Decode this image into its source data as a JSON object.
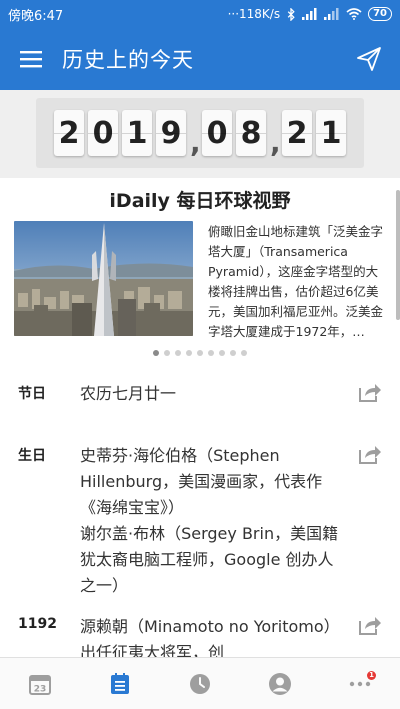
{
  "status_bar": {
    "time": "傍晚6:47",
    "network_speed": "···118K/s",
    "battery": "70"
  },
  "app_bar": {
    "title": "历史上的今天",
    "menu_icon": "hamburger-menu-icon",
    "send_icon": "paper-plane-icon"
  },
  "date": {
    "year": [
      "2",
      "0",
      "1",
      "9"
    ],
    "month": [
      "0",
      "8"
    ],
    "day": [
      "2",
      "1"
    ],
    "separator": ","
  },
  "idaily": {
    "title": "iDaily 每日环球视野",
    "summary": "俯瞰旧金山地标建筑「泛美金字塔大厦」（Transamerica Pyramid），这座金字塔型的大楼将挂牌出售，估价超过6亿美元，美国加利福尼亚州。泛美金字塔大厦建成于1972年，…",
    "dots_total": 9,
    "dots_active_index": 0
  },
  "events": [
    {
      "label": "节日",
      "text": "农历七月廿一"
    },
    {
      "label": "生日",
      "text": "史蒂芬·海伦伯格（Stephen Hillenburg，美国漫画家，代表作《海绵宝宝》）\n谢尔盖·布林（Sergey Brin，美国籍犹太裔电脑工程师，Google 创办人之一）"
    },
    {
      "label": "1192",
      "text": "源赖朝（Minamoto no Yoritomo）出任征夷大将军，创"
    }
  ],
  "bottom_nav": {
    "items": [
      {
        "name": "calendar-tab",
        "icon": "calendar-icon",
        "calendar_number": "23",
        "active": false
      },
      {
        "name": "list-tab",
        "icon": "list-icon",
        "active": true
      },
      {
        "name": "clock-tab",
        "icon": "clock-icon",
        "active": false
      },
      {
        "name": "profile-tab",
        "icon": "avatar-icon",
        "active": false
      },
      {
        "name": "more-tab",
        "icon": "more-dots-icon",
        "active": false,
        "badge": "1"
      }
    ]
  },
  "colors": {
    "primary": "#2979d2",
    "accent_active": "#2979d2",
    "inactive_icon": "#9e9e9e",
    "badge": "#e53935"
  }
}
